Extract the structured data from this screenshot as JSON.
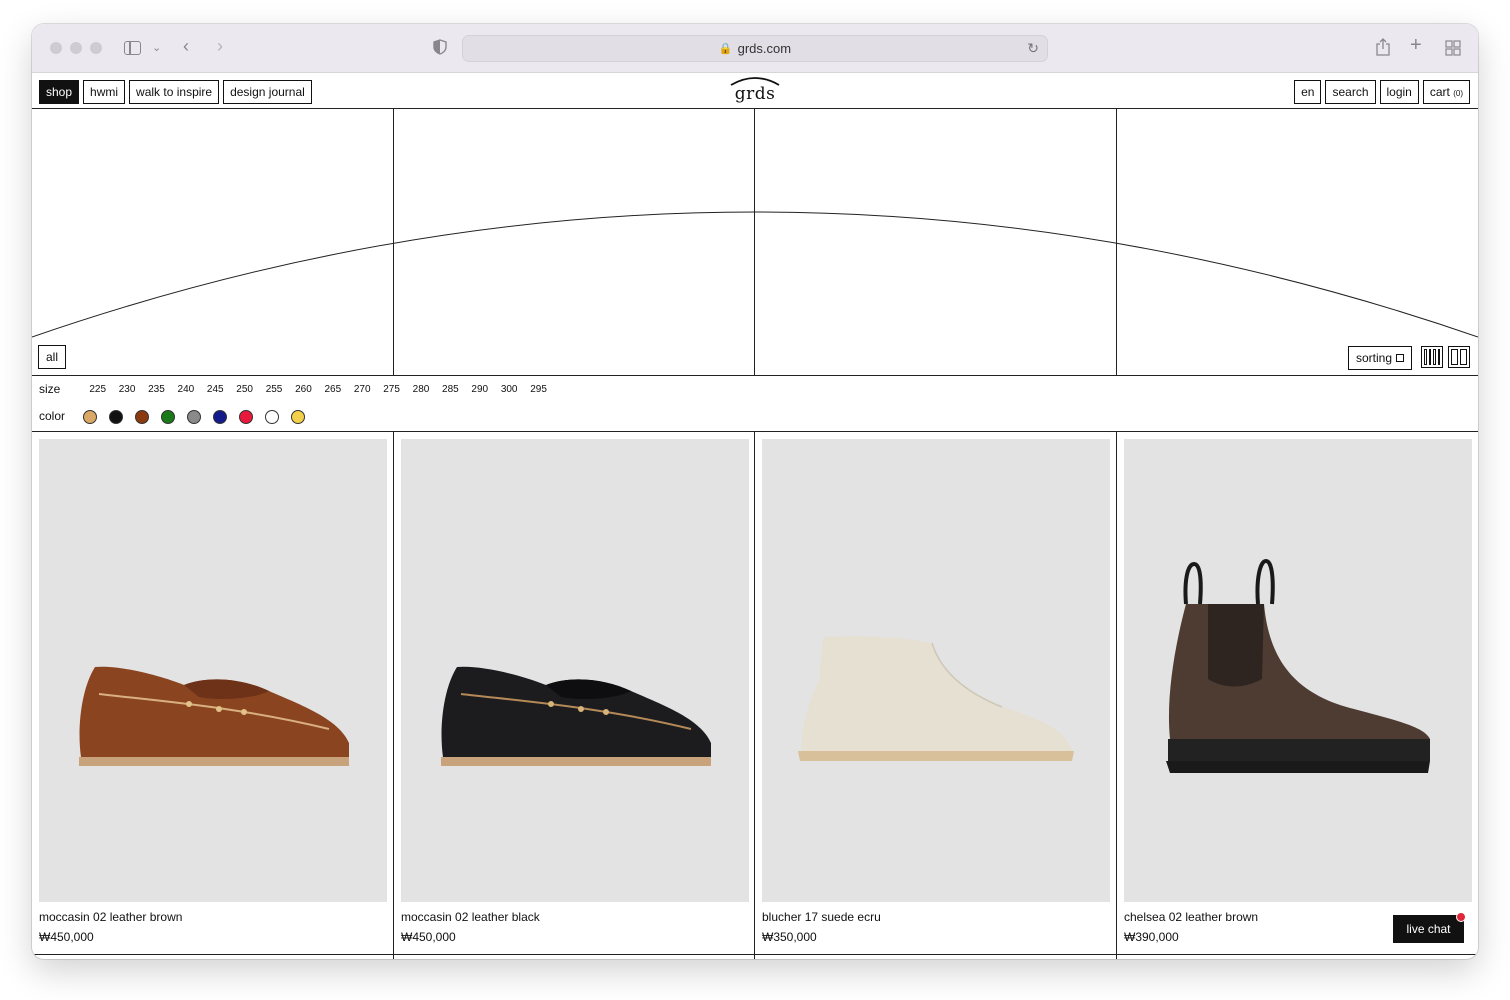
{
  "browser": {
    "url": "grds.com"
  },
  "header": {
    "logo": "grds",
    "nav_left": [
      {
        "label": "shop",
        "active": true
      },
      {
        "label": "hwmi",
        "active": false
      },
      {
        "label": "walk to inspire",
        "active": false
      },
      {
        "label": "design journal",
        "active": false
      }
    ],
    "lang": "en",
    "search": "search",
    "login": "login",
    "cart_label": "cart",
    "cart_count": "(0)"
  },
  "hero": {
    "all_label": "all",
    "sorting_label": "sorting"
  },
  "filters": {
    "size_label": "size",
    "sizes": [
      "225",
      "230",
      "235",
      "240",
      "245",
      "250",
      "255",
      "260",
      "265",
      "270",
      "275",
      "280",
      "285",
      "290",
      "300",
      "295"
    ],
    "color_label": "color",
    "colors": [
      "#d9a864",
      "#111111",
      "#8b3a10",
      "#1a7a1a",
      "#8a8a8a",
      "#141c8c",
      "#e8193c",
      "#ffffff",
      "#f2d04c"
    ]
  },
  "products": [
    {
      "name": "moccasin 02 leather brown",
      "price": "₩450,000"
    },
    {
      "name": "moccasin 02 leather black",
      "price": "₩450,000"
    },
    {
      "name": "blucher 17 suede ecru",
      "price": "₩350,000"
    },
    {
      "name": "chelsea 02 leather brown",
      "price": "₩390,000"
    }
  ],
  "live_chat": "live chat"
}
